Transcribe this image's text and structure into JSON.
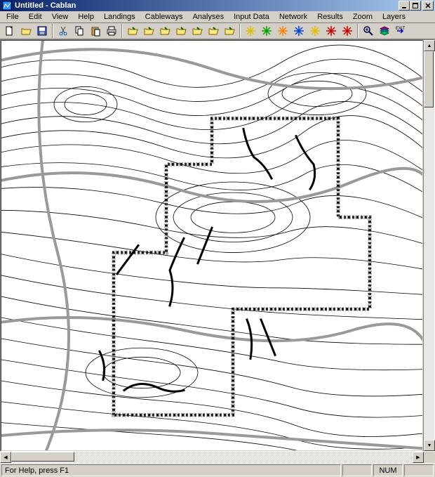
{
  "window": {
    "title": "Untitled - Cablan"
  },
  "menu": {
    "items": [
      "File",
      "Edit",
      "View",
      "Help",
      "Landings",
      "Cableways",
      "Analyses",
      "Input Data",
      "Network",
      "Results",
      "Zoom",
      "Layers"
    ]
  },
  "toolbar": {
    "items": [
      {
        "name": "new-icon",
        "glyph": "new"
      },
      {
        "name": "open-icon",
        "glyph": "open"
      },
      {
        "name": "save-icon",
        "glyph": "save"
      },
      {
        "name": "cut-icon",
        "glyph": "cut"
      },
      {
        "name": "copy-icon",
        "glyph": "copy"
      },
      {
        "name": "paste-icon",
        "glyph": "paste"
      },
      {
        "name": "print-icon",
        "glyph": "print"
      },
      {
        "name": "open-folder-1-icon",
        "glyph": "folder"
      },
      {
        "name": "open-folder-2-icon",
        "glyph": "folder"
      },
      {
        "name": "open-folder-3-icon",
        "glyph": "folder"
      },
      {
        "name": "open-folder-4-icon",
        "glyph": "folder"
      },
      {
        "name": "open-folder-5-icon",
        "glyph": "folder"
      },
      {
        "name": "open-folder-6-icon",
        "glyph": "folder"
      },
      {
        "name": "open-folder-7-icon",
        "glyph": "folder"
      },
      {
        "name": "tool-yellow-1-icon",
        "glyph": "burst-y"
      },
      {
        "name": "tool-green-icon",
        "glyph": "burst-g"
      },
      {
        "name": "tool-orange-icon",
        "glyph": "burst-o"
      },
      {
        "name": "tool-blue-icon",
        "glyph": "burst-b"
      },
      {
        "name": "tool-yellow-2-icon",
        "glyph": "burst-y"
      },
      {
        "name": "tool-red-icon",
        "glyph": "burst-r"
      },
      {
        "name": "tool-red-2-icon",
        "glyph": "burst-r"
      },
      {
        "name": "magnify-plus-icon",
        "glyph": "zoom"
      },
      {
        "name": "layers-icon",
        "glyph": "layers"
      },
      {
        "name": "exit-icon",
        "glyph": "exit"
      }
    ]
  },
  "status": {
    "help": "For Help, press F1",
    "numlock": "NUM"
  }
}
